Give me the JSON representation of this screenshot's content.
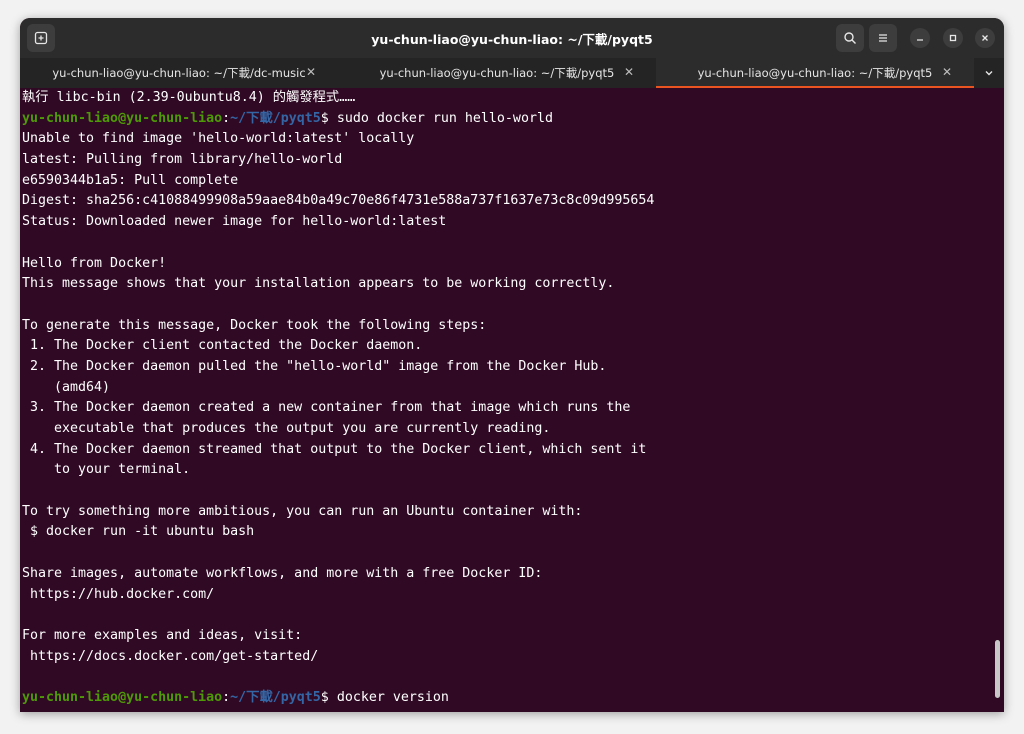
{
  "window": {
    "title": "yu-chun-liao@yu-chun-liao: ~/下載/pyqt5"
  },
  "tabs": [
    {
      "label": "yu-chun-liao@yu-chun-liao: ~/下載/dc-music",
      "close": "✕"
    },
    {
      "label": "yu-chun-liao@yu-chun-liao: ~/下載/pyqt5",
      "close": "✕"
    },
    {
      "label": "yu-chun-liao@yu-chun-liao: ~/下載/pyqt5",
      "close": "✕"
    }
  ],
  "colors": {
    "terminal_bg": "#300a24",
    "prompt_user": "#4e9a06",
    "prompt_path": "#3465a4",
    "accent": "#e95420"
  },
  "icons": {
    "new_tab": "new-tab-icon",
    "search": "search-icon",
    "menu": "hamburger-menu-icon",
    "minimize": "minimize-icon",
    "maximize": "maximize-icon",
    "close": "close-icon",
    "tab_list": "chevron-down-icon"
  },
  "terminal": {
    "prompt1": {
      "user": "yu-chun-liao@yu-chun-liao",
      "sep": ":",
      "path": "~/下載/pyqt5",
      "dollar": "$",
      "cmd": " sudo docker run hello-world"
    },
    "prompt2": {
      "user": "yu-chun-liao@yu-chun-liao",
      "sep": ":",
      "path": "~/下載/pyqt5",
      "dollar": "$",
      "cmd": " docker version"
    },
    "lines": [
      "執行 libc-bin (2.39-0ubuntu8.4) 的觸發程式……",
      "Unable to find image 'hello-world:latest' locally",
      "latest: Pulling from library/hello-world",
      "e6590344b1a5: Pull complete",
      "Digest: sha256:c41088499908a59aae84b0a49c70e86f4731e588a737f1637e73c8c09d995654",
      "Status: Downloaded newer image for hello-world:latest",
      "",
      "Hello from Docker!",
      "This message shows that your installation appears to be working correctly.",
      "",
      "To generate this message, Docker took the following steps:",
      " 1. The Docker client contacted the Docker daemon.",
      " 2. The Docker daemon pulled the \"hello-world\" image from the Docker Hub.",
      "    (amd64)",
      " 3. The Docker daemon created a new container from that image which runs the",
      "    executable that produces the output you are currently reading.",
      " 4. The Docker daemon streamed that output to the Docker client, which sent it",
      "    to your terminal.",
      "",
      "To try something more ambitious, you can run an Ubuntu container with:",
      " $ docker run -it ubuntu bash",
      "",
      "Share images, automate workflows, and more with a free Docker ID:",
      " https://hub.docker.com/",
      "",
      "For more examples and ideas, visit:",
      " https://docs.docker.com/get-started/",
      ""
    ]
  }
}
